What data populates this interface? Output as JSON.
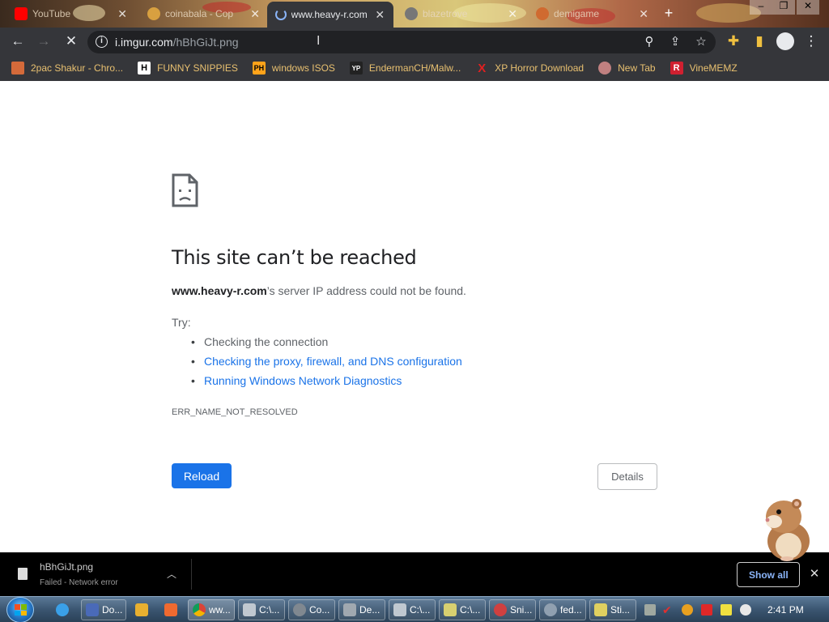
{
  "tabs": [
    {
      "title": "YouTube",
      "favicon_color": "#ff0000",
      "active": false
    },
    {
      "title": "coinabala - Cop",
      "favicon_color": "#d8a040",
      "active": false
    },
    {
      "title": "www.heavy-r.com",
      "favicon_color": "#8ab4f8",
      "active": true
    },
    {
      "title": "blazetrove",
      "favicon_color": "#777777",
      "active": false
    },
    {
      "title": "demigame",
      "favicon_color": "#d06a30",
      "active": false
    }
  ],
  "toolbar": {
    "back_icon": "arrow-left-icon",
    "forward_icon": "arrow-right-icon",
    "stop_icon": "stop-x-icon",
    "url_domain": "i.imgur.com",
    "url_path": "/hBhGiJt.png"
  },
  "bookmarks": [
    {
      "label": "2pac Shakur - Chro...",
      "icon_text": "",
      "icon_color": "#d46a3a"
    },
    {
      "label": "FUNNY SNIPPIES",
      "icon_text": "H",
      "icon_color": "#ffffff"
    },
    {
      "label": "windows ISOS",
      "icon_text": "PH",
      "icon_color": "#ffa31a"
    },
    {
      "label": "EndermanCH/Malw...",
      "icon_text": "YP",
      "icon_color": "#222222"
    },
    {
      "label": "XP Horror Download",
      "icon_text": "X",
      "icon_color": "#e02020"
    },
    {
      "label": "New Tab",
      "icon_text": "",
      "icon_color": "#c08080"
    },
    {
      "label": "VineMEMZ",
      "icon_text": "R",
      "icon_color": "#d02030"
    }
  ],
  "error": {
    "title": "This site can’t be reached",
    "host": "www.heavy-r.com",
    "desc_rest": "’s server IP address could not be found.",
    "try_label": "Try:",
    "suggestions": [
      {
        "text": "Checking the connection",
        "link": false
      },
      {
        "text": "Checking the proxy, firewall, and DNS configuration",
        "link": true
      },
      {
        "text": "Running Windows Network Diagnostics",
        "link": true
      }
    ],
    "code": "ERR_NAME_NOT_RESOLVED",
    "reload_label": "Reload",
    "details_label": "Details"
  },
  "download": {
    "filename": "hBhGiJt.png",
    "status": "Failed - Network error",
    "show_all_label": "Show all"
  },
  "taskbar": {
    "items": [
      {
        "label": "",
        "icon_color": "#3aa0e8"
      },
      {
        "label": "Do...",
        "icon_color": "#4a6ab8"
      },
      {
        "label": "",
        "icon_color": "#e8b030"
      },
      {
        "label": "",
        "icon_color": "#f06a30"
      },
      {
        "label": "ww...",
        "icon_color": "#e8d040"
      },
      {
        "label": "C:\\...",
        "icon_color": "#c0c8d0"
      },
      {
        "label": "Co...",
        "icon_color": "#808890"
      },
      {
        "label": "De...",
        "icon_color": "#a0a8b0"
      },
      {
        "label": "C:\\...",
        "icon_color": "#c0c8d0"
      },
      {
        "label": "C:\\...",
        "icon_color": "#d8d070"
      },
      {
        "label": "Sni...",
        "icon_color": "#d04040"
      },
      {
        "label": "fed...",
        "icon_color": "#90a0b0"
      },
      {
        "label": "Sti...",
        "icon_color": "#e0d060"
      }
    ],
    "clock": "2:41 PM"
  }
}
